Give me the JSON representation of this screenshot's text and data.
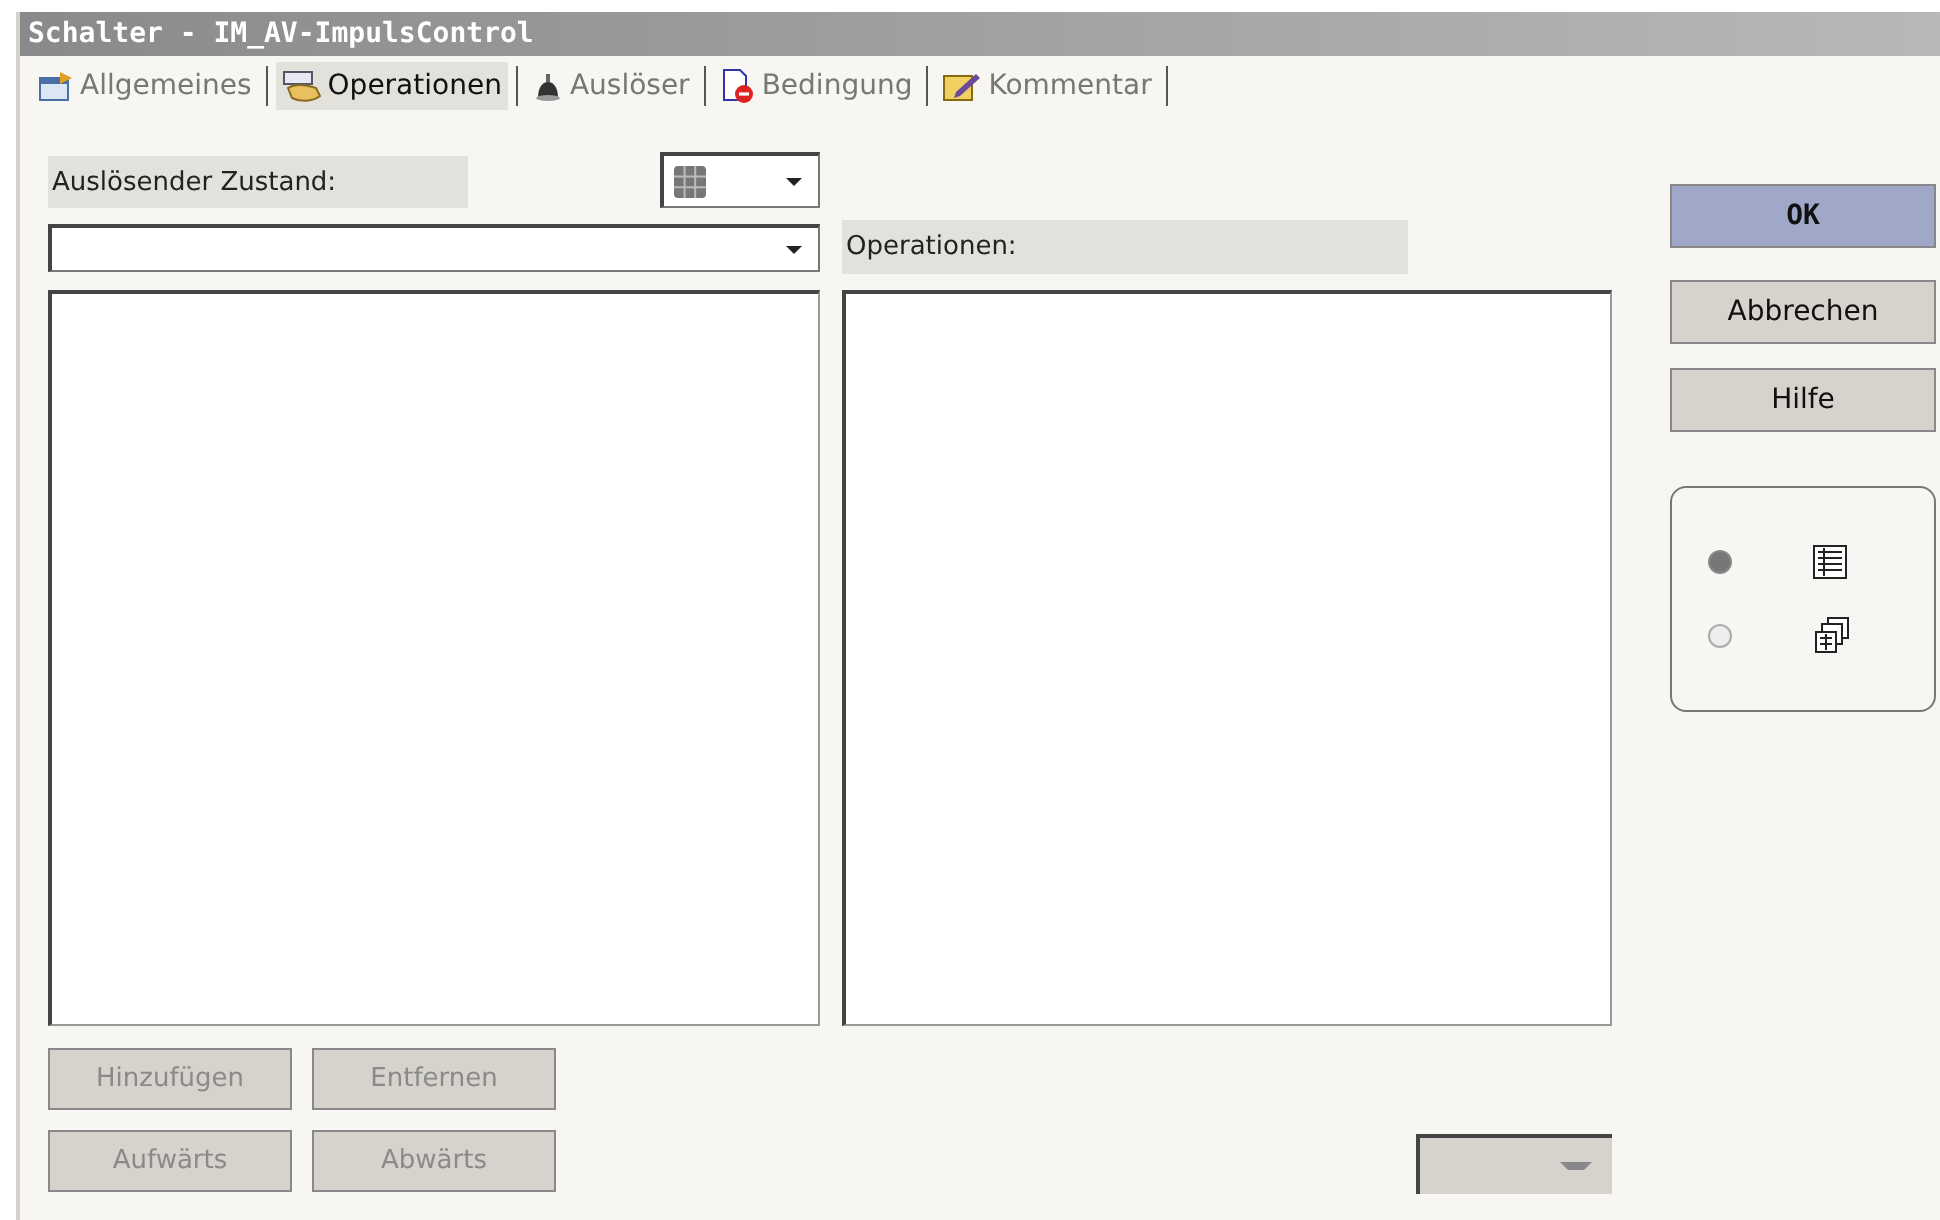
{
  "window": {
    "title": "Schalter - IM_AV-ImpulsControl"
  },
  "tabs": [
    {
      "label": "Allgemeines",
      "selected": false
    },
    {
      "label": "Operationen",
      "selected": true
    },
    {
      "label": "Auslöser",
      "selected": false
    },
    {
      "label": "Bedingung",
      "selected": false
    },
    {
      "label": "Kommentar",
      "selected": false
    }
  ],
  "trigger_state": {
    "label": "Auslösender Zustand:"
  },
  "operations": {
    "label": "Operationen:"
  },
  "list_buttons": [
    {
      "label": "Hinzufügen",
      "disabled": true
    },
    {
      "label": "Entfernen",
      "disabled": true
    },
    {
      "label": "Aufwärts",
      "disabled": true
    },
    {
      "label": "Abwärts",
      "disabled": true
    }
  ],
  "dialog_buttons": [
    {
      "label": "OK",
      "kind": "default"
    },
    {
      "label": "Abbrechen",
      "kind": "normal"
    },
    {
      "label": "Hilfe",
      "kind": "normal"
    }
  ],
  "view_options": [
    {
      "selected": true
    },
    {
      "selected": false
    }
  ]
}
